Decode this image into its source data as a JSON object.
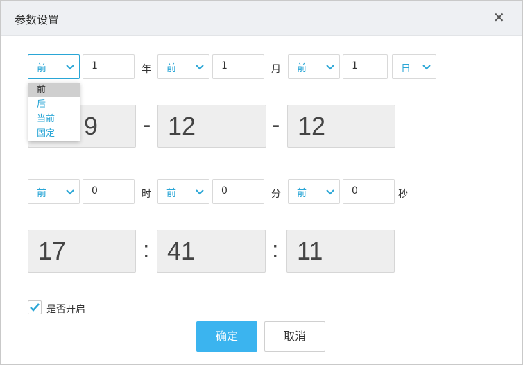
{
  "dialog": {
    "title": "参数设置",
    "close_label": "✕"
  },
  "date_row": {
    "year": {
      "direction": "前",
      "value": "1",
      "unit": "年"
    },
    "month": {
      "direction": "前",
      "value": "1",
      "unit": "月"
    },
    "day": {
      "direction": "前",
      "value": "1",
      "unit": "日"
    }
  },
  "dropdown": {
    "options": [
      "前",
      "后",
      "当前",
      "固定"
    ],
    "highlighted_index": 0
  },
  "date_display": {
    "year": "9",
    "month": "12",
    "day": "12",
    "separator": "-"
  },
  "time_row": {
    "hour": {
      "direction": "前",
      "value": "0",
      "unit": "时"
    },
    "minute": {
      "direction": "前",
      "value": "0",
      "unit": "分"
    },
    "second": {
      "direction": "前",
      "value": "0",
      "unit": "秒"
    }
  },
  "time_display": {
    "hour": "17",
    "minute": "41",
    "second": "11",
    "separator": ":"
  },
  "enable": {
    "label": "是否开启",
    "checked": true
  },
  "buttons": {
    "confirm": "确定",
    "cancel": "取消"
  },
  "colors": {
    "accent": "#2aa6d6",
    "primary_button": "#3bb4ef",
    "header_bg": "#eef0f3"
  }
}
